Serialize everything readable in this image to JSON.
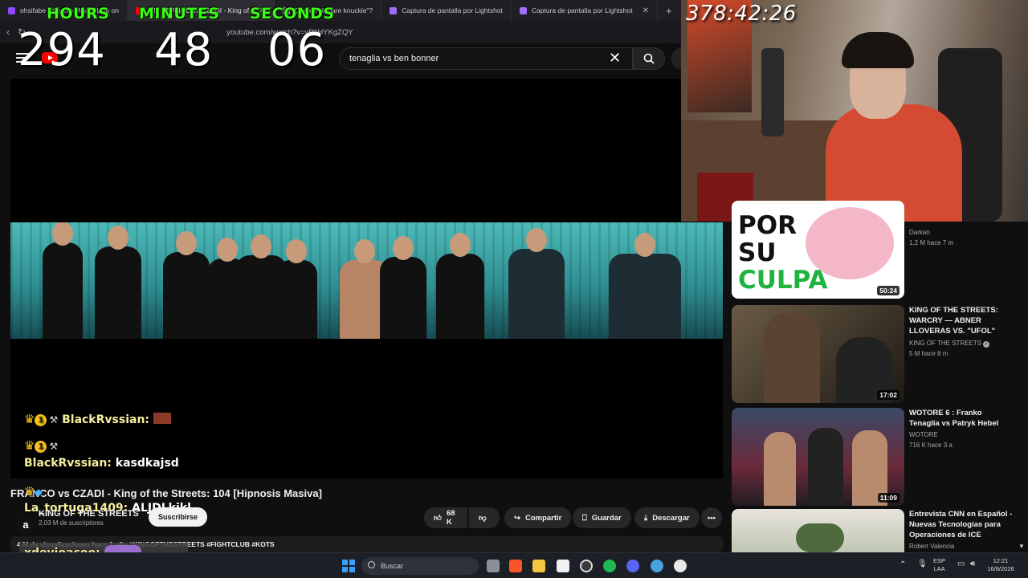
{
  "browser": {
    "tabs": [
      {
        "label": "ohsifabe Stream - Watch Live on",
        "color": "#9146ff",
        "active": false
      },
      {
        "label": "(55) FRANCO vs CZADI - King of",
        "color": "#ff0000",
        "active": true
      },
      {
        "label": "Qué es el \"bare knuckle\"?",
        "color": "#888888",
        "active": false
      },
      {
        "label": "Captura de pantalla por Lightshot",
        "color": "#a16cff",
        "active": false
      },
      {
        "label": "Captura de pantalla por Lightshot",
        "color": "#a16cff",
        "active": false
      }
    ],
    "new_tab": "+",
    "url": "youtube.com/watch?v=vRliHYKgZQY"
  },
  "youtube": {
    "search_value": "tenaglia vs ben bonner",
    "clear_icon": "close-icon",
    "search_icon": "search-icon"
  },
  "timer_overlay": {
    "hours_label": "HOURS",
    "minutes_label": "MINUTES",
    "seconds_label": "SECONDS",
    "hours": "294",
    "minutes": "48",
    "seconds": "06"
  },
  "stream_timer": "378:42:26",
  "chat": [
    {
      "badge_num": "1",
      "user": "BlackRvssian:",
      "message": ""
    },
    {
      "badge_num": "1",
      "user": "",
      "message": ""
    },
    {
      "badge_num": "",
      "user": "BlackRvssian:",
      "message": "kasdkajsd"
    },
    {
      "badge_num": "",
      "user": "La_tortuga1409:",
      "message": "ALJDLkjkl"
    },
    {
      "badge_num": "",
      "user": "xdeyjoacoo:",
      "message": ""
    }
  ],
  "video": {
    "title": "FRANCO vs CZADI - King of the Streets: 104 [Hipnosis Masiva]",
    "channel_avatar": "a",
    "channel_name": "KING OF THE STREETS",
    "subscribers": "2,03 M de suscriptores",
    "subscribe_label": "Suscribirse",
    "likes": "68 K",
    "share_label": "Compartir",
    "save_label": "Guardar",
    "download_label": "Descargar",
    "more_label": "•••",
    "description": "4 M de visualizaciones  hace 1 año  #KINGOFTHESTREETS #FIGHTCLUB #KOTS"
  },
  "recommended": [
    {
      "title": "",
      "channel": "Darkan",
      "meta": "1,2 M  hace 7 m",
      "duration": "50:24",
      "thumb_text": [
        "POR",
        "SU",
        "CULPA"
      ],
      "verified": false
    },
    {
      "title": "KING OF THE STREETS: WARCRY — ABNER LLOVERAS VS. \"UFOL\"",
      "channel": "KING OF THE STREETS",
      "meta": "5 M  hace 8 m",
      "duration": "17:02",
      "verified": true
    },
    {
      "title": "WOTORE 6 : Franko Tenaglia vs Patryk Hebel",
      "channel": "WOTORE",
      "meta": "716 K  hace 3 a",
      "duration": "11:09",
      "verified": false
    },
    {
      "title": "Entrevista CNN en Español - Nuevas Tecnologías para Operaciones de ICE",
      "channel": "Robert Valencia",
      "meta": "",
      "duration": "",
      "verified": false
    }
  ],
  "taskbar": {
    "search_placeholder": "Buscar",
    "lang_top": "ESP",
    "lang_bottom": "LAA",
    "time": "12:21",
    "date": "16/8/2026",
    "apps": [
      "file-explorer-icon",
      "brave-icon",
      "folder-icon",
      "dexter-icon",
      "chrome-icon",
      "spotify-icon",
      "discord-icon",
      "ccleaner-icon",
      "skull-icon"
    ]
  },
  "colors": {
    "accent_green": "#39ff14",
    "yt_red": "#ff0000",
    "chat_user": "#f6ee9e"
  }
}
